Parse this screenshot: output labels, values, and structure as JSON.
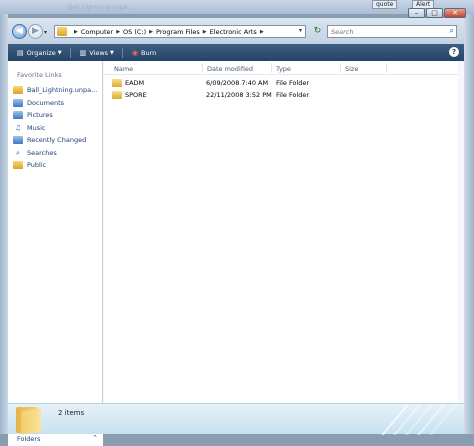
{
  "background": {
    "title": "Ball_Lightning.unpa...",
    "tab_quote": "quote",
    "tab_alert": "Alert"
  },
  "caption": {
    "minimize": "–",
    "maximize": "□",
    "close": "✕"
  },
  "address_bar": {
    "crumbs": [
      "Computer",
      "OS (C:)",
      "Program Files",
      "Electronic Arts"
    ],
    "separator": "▶",
    "dropdown": "▾",
    "refresh": "↻",
    "search_placeholder": "Search"
  },
  "toolbar": {
    "organize": "Organize",
    "views": "Views",
    "burn": "Burn",
    "help": "?"
  },
  "nav_pane": {
    "heading": "Favorite Links",
    "items": [
      {
        "label": "Ball_Lightning.unpa...",
        "icon": "folder-icon"
      },
      {
        "label": "Documents",
        "icon": "documents-icon"
      },
      {
        "label": "Pictures",
        "icon": "pictures-icon"
      },
      {
        "label": "Music",
        "icon": "music-icon"
      },
      {
        "label": "Recently Changed",
        "icon": "recent-icon"
      },
      {
        "label": "Searches",
        "icon": "search-icon"
      },
      {
        "label": "Public",
        "icon": "folder-icon"
      }
    ],
    "folders_label": "Folders",
    "folders_chevron": "⌃"
  },
  "columns": {
    "name": "Name",
    "date": "Date modified",
    "type": "Type",
    "size": "Size"
  },
  "files": [
    {
      "name": "EADM",
      "date": "6/09/2008 7:40 AM",
      "type": "File Folder"
    },
    {
      "name": "SPORE",
      "date": "22/11/2008 3:52 PM",
      "type": "File Folder"
    }
  ],
  "details": {
    "items_count": "2 items"
  }
}
